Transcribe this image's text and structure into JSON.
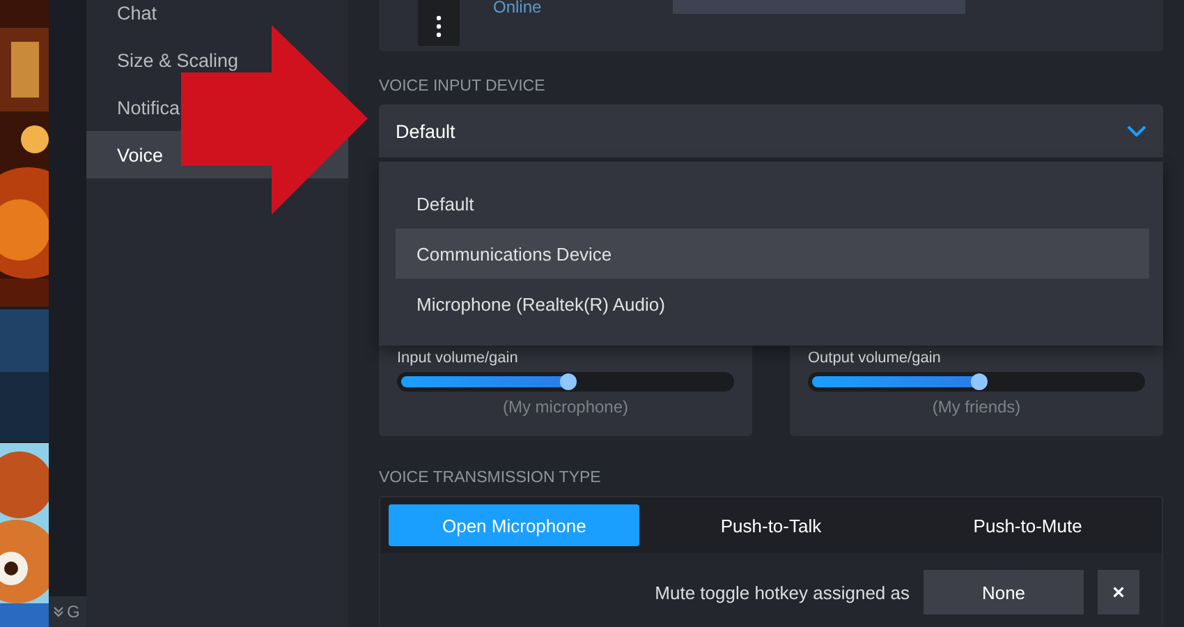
{
  "library_strip": {
    "footer_letter": "G"
  },
  "sidebar": {
    "items": [
      {
        "label": "Chat",
        "selected": false
      },
      {
        "label": "Size & Scaling",
        "selected": false
      },
      {
        "label": "Notifica",
        "selected": false
      },
      {
        "label": "Voice",
        "selected": true
      }
    ]
  },
  "profile": {
    "status": "Online"
  },
  "voice_input_device": {
    "label": "VOICE INPUT DEVICE",
    "value": "Default",
    "expanded": true,
    "options": [
      {
        "label": "Default",
        "highlighted": false
      },
      {
        "label": "Communications Device",
        "highlighted": true
      },
      {
        "label": "Microphone (Realtek(R) Audio)",
        "highlighted": false
      }
    ]
  },
  "volume": [
    {
      "label": "Input volume/gain",
      "level": 0.5,
      "caption": "(My microphone)"
    },
    {
      "label": "Output volume/gain",
      "level": 0.5,
      "caption": "(My friends)"
    }
  ],
  "transmission": {
    "label": "VOICE TRANSMISSION TYPE",
    "modes": [
      {
        "label": "Open Microphone",
        "selected": true
      },
      {
        "label": "Push-to-Talk",
        "selected": false
      },
      {
        "label": "Push-to-Mute",
        "selected": false
      }
    ],
    "hotkey_label": "Mute toggle hotkey assigned as",
    "hotkey_value": "None",
    "clear_button": "×"
  }
}
